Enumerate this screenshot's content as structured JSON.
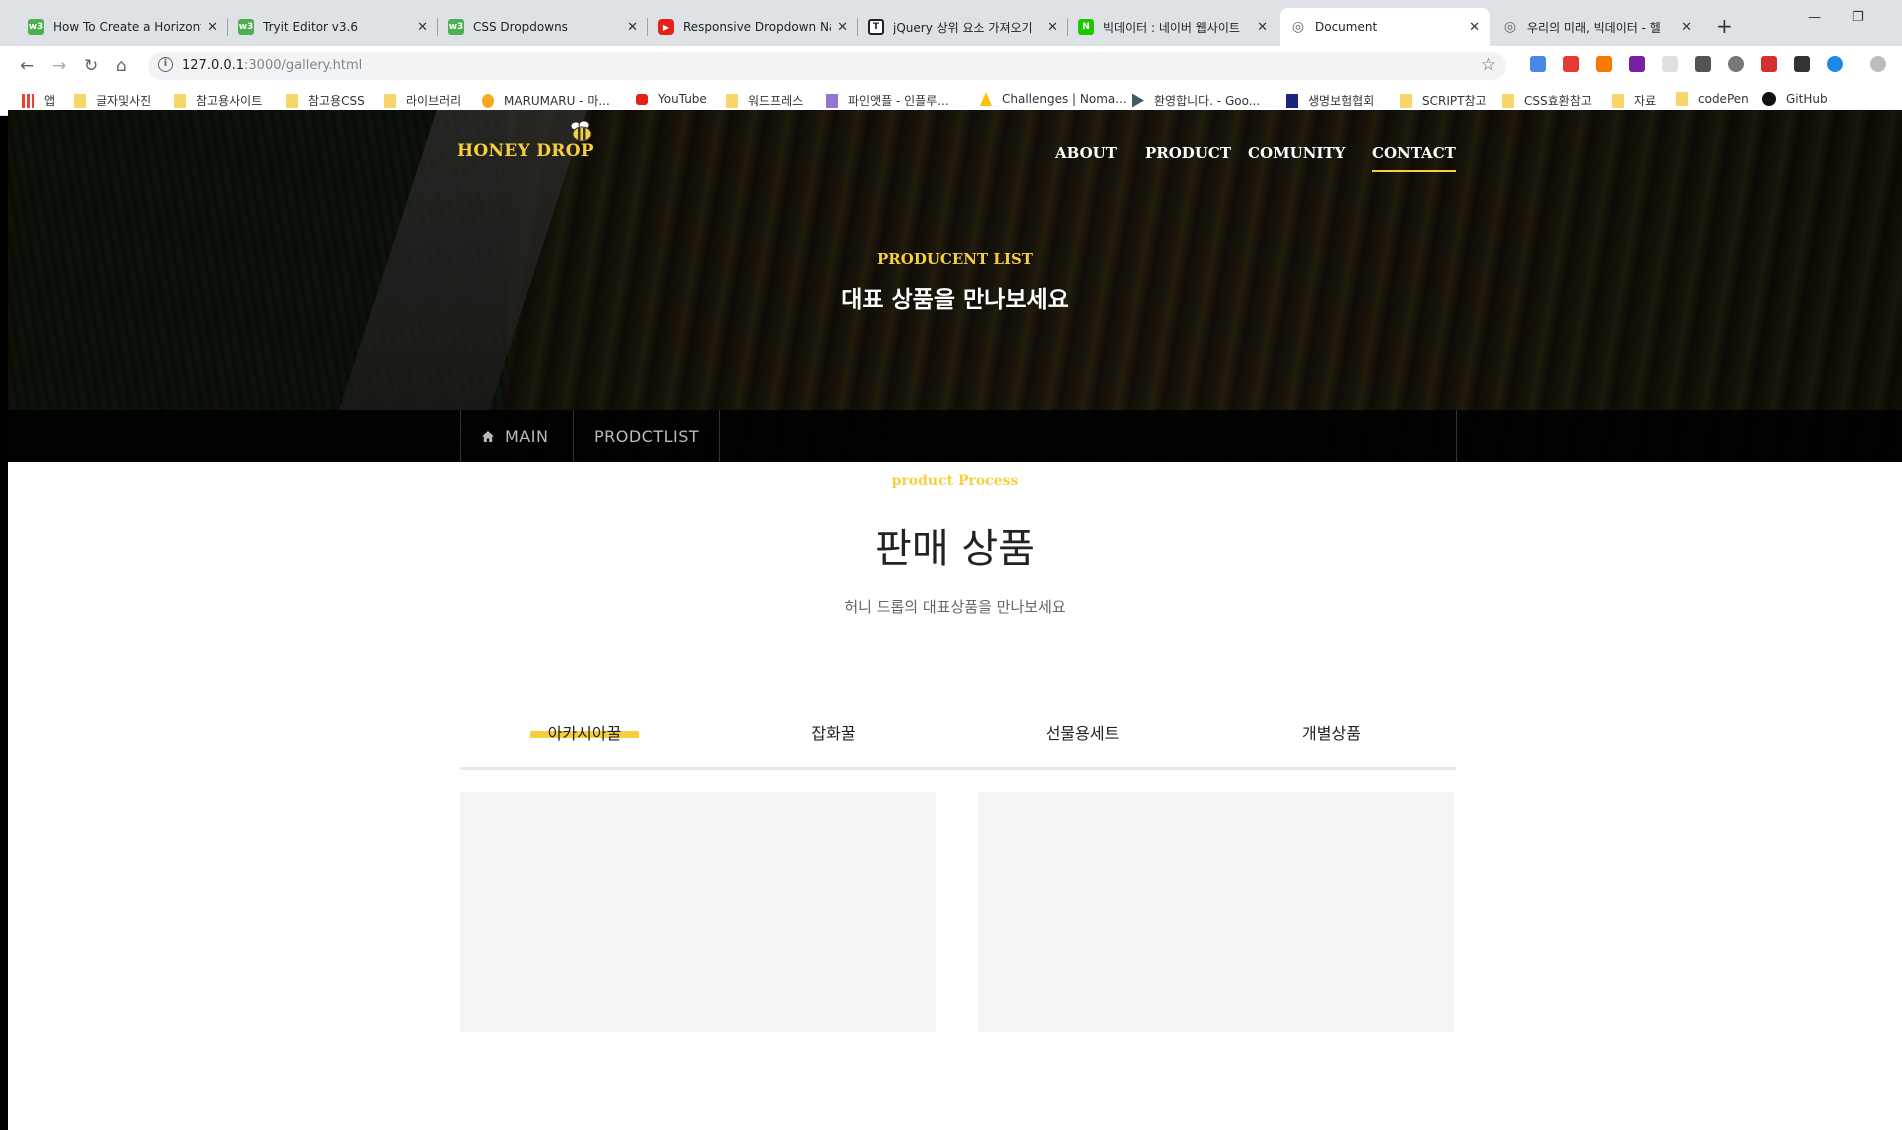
{
  "browser": {
    "tabs": [
      {
        "title": "How To Create a Horizonta",
        "favicon_color": "#4caf50",
        "favicon_text": "w3"
      },
      {
        "title": "Tryit Editor v3.6",
        "favicon_color": "#4caf50",
        "favicon_text": "w3"
      },
      {
        "title": "CSS Dropdowns",
        "favicon_color": "#4caf50",
        "favicon_text": "w3"
      },
      {
        "title": "Responsive Dropdown Nav",
        "favicon_color": "#e62117",
        "favicon_text": "▶"
      },
      {
        "title": "jQuery 상위 요소 가져오기",
        "favicon_color": "#222222",
        "favicon_text": "T"
      },
      {
        "title": "빅데이터 : 네이버 웹사이트",
        "favicon_color": "#1ec800",
        "favicon_text": "N"
      },
      {
        "title": "Document",
        "favicon_color": "#5f6368",
        "favicon_text": "◎"
      },
      {
        "title": "우리의 미래, 빅데이터 - 헬",
        "favicon_color": "#5f6368",
        "favicon_text": "◎"
      }
    ],
    "active_tab_index": 6,
    "url_host": "127.0.0.1",
    "url_rest": ":3000/gallery.html",
    "bookmarks": [
      {
        "label": "앱",
        "icon": "apps-icon"
      },
      {
        "label": "글자및사진",
        "icon": "folder-icon"
      },
      {
        "label": "참고용사이트",
        "icon": "folder-icon"
      },
      {
        "label": "참고용CSS",
        "icon": "folder-icon"
      },
      {
        "label": "라이브러리",
        "icon": "folder-icon"
      },
      {
        "label": "MARUMARU - 마...",
        "icon": "marumaru-icon"
      },
      {
        "label": "YouTube",
        "icon": "youtube-icon"
      },
      {
        "label": "워드프레스",
        "icon": "folder-icon"
      },
      {
        "label": "파인앳플 - 인플루...",
        "icon": "pinapple-icon"
      },
      {
        "label": "Challenges | Noma...",
        "icon": "nomad-icon"
      },
      {
        "label": "환영합니다. - Goo...",
        "icon": "google-icon"
      },
      {
        "label": "생명보험협회",
        "icon": "klia-icon"
      },
      {
        "label": "SCRIPT참고",
        "icon": "folder-icon"
      },
      {
        "label": "CSS효환참고",
        "icon": "folder-icon"
      },
      {
        "label": "자료",
        "icon": "folder-icon"
      },
      {
        "label": "codePen",
        "icon": "folder-icon"
      },
      {
        "label": "GitHub",
        "icon": "github-icon"
      }
    ]
  },
  "site": {
    "logo": "HONEY DROP",
    "nav": [
      "ABOUT",
      "PRODUCT",
      "COMUNITY",
      "CONTACT"
    ],
    "active_nav": "CONTACT",
    "hero_subtitle": "PRODUCENT LIST",
    "hero_title": "대표 상품을 만나보세요",
    "breadcrumb": [
      "MAIN",
      "PRODCTLIST"
    ]
  },
  "section": {
    "eyebrow": "product Process",
    "title": "판매 상품",
    "description": "허니 드롭의 대표상품을 만나보세요",
    "tabs": [
      "아카시아꿀",
      "잡화꿀",
      "선물용세트",
      "개별상품"
    ],
    "active_tab": "아카시아꿀"
  },
  "colors": {
    "accent": "#f7cf3e",
    "hero_dark": "#1d170e",
    "card_bg": "#f4f4f4"
  }
}
